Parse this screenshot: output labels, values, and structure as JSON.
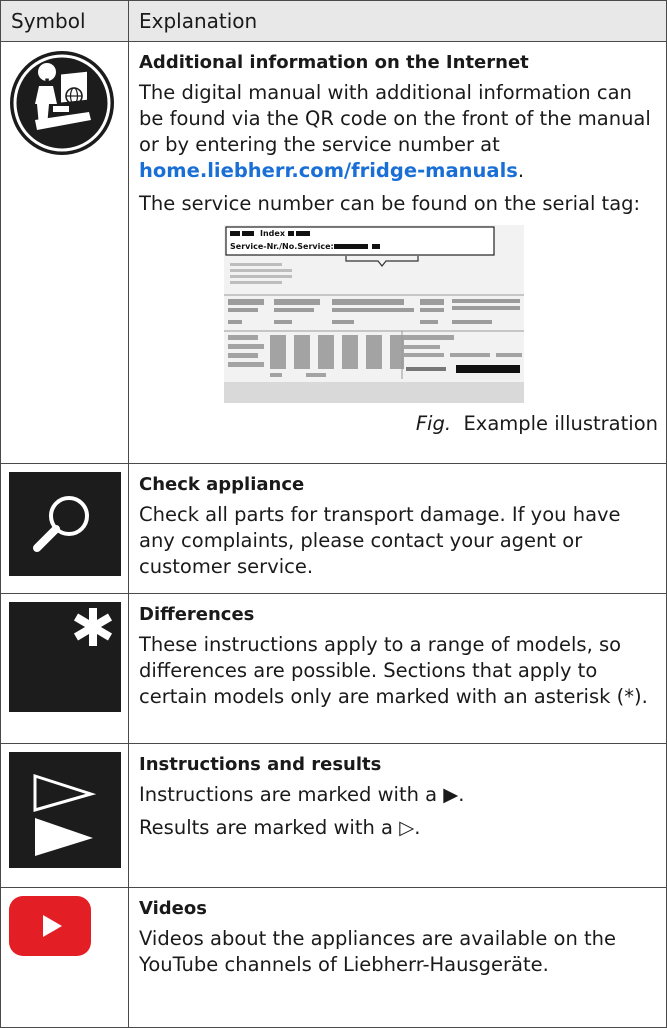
{
  "header": {
    "symbol": "Symbol",
    "explanation": "Explanation"
  },
  "rows": [
    {
      "icon": "info-internet-icon",
      "title": "Additional information on the Internet",
      "p1_pre": "The digital manual with additional information can be found via the QR code on the front of the manual or by entering the service number at ",
      "p1_link": "home.liebherr.com/fridge-manuals",
      "p1_post": ".",
      "p2": "The service number can be found on the serial tag:",
      "tag_index": "Index",
      "tag_service": "Service-Nr./No.Service:",
      "caption_fig": "Fig.",
      "caption_text": "Example illustration"
    },
    {
      "icon": "magnifier-icon",
      "title": "Check appliance",
      "text": "Check all parts for transport damage. If you have any complaints, please contact your agent or customer service."
    },
    {
      "icon": "asterisk-icon",
      "title": "Differences",
      "text": "These instructions apply to a range of models, so differences are possible. Sections that apply to certain models only are marked with an asterisk (*)."
    },
    {
      "icon": "instruction-arrows-icon",
      "title": "Instructions and results",
      "text1": "Instructions are marked with a ▶.",
      "text2": "Results are marked with a ▷."
    },
    {
      "icon": "youtube-play-icon",
      "title": "Videos",
      "text": "Videos about the appliances are available on the YouTube channels of Liebherr-Hausgeräte."
    }
  ]
}
